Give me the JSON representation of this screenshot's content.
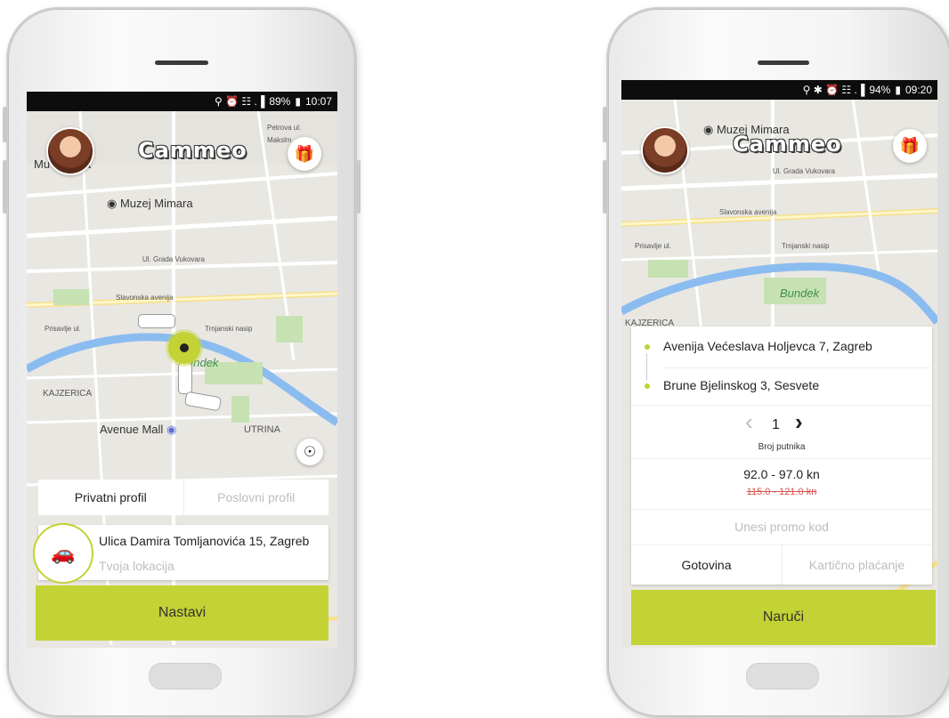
{
  "phone1": {
    "status": {
      "icons": "⚲ ⏰ ☷ .▐",
      "battery": "89%",
      "time": "10:07"
    },
    "brand": "Cammeo",
    "map_labels": {
      "poi_left": "Mu",
      "poi_left2": "ja",
      "muzej": "Muzej Mimara",
      "grada": "Ul. Grada Vukovara",
      "slavonska": "Slavonska avenija",
      "prisavlje": "Prisavlje ul.",
      "trnjanski": "Trnjanski nasip",
      "bundek": "undek",
      "kajzerica": "KAJZERICA",
      "avenue_mall": "Avenue Mall",
      "utrina": "UTRINA",
      "makslm": "Makslm",
      "petrova": "Petrova ul."
    },
    "profile_tabs": {
      "private": "Privatni profil",
      "business": "Poslovni profil"
    },
    "address": {
      "from": "Ulica Damira Tomljanovića 15, Zagreb",
      "location_placeholder": "Tvoja lokacija"
    },
    "continue_button": "Nastavi"
  },
  "phone2": {
    "status": {
      "icons": "⚲ ✱ ⏰ ☷ .▐",
      "battery": "94%",
      "time": "09:20"
    },
    "brand": "Cammeo",
    "map_labels": {
      "muzej": "Muzej Mimara",
      "grada": "Ul. Grada Vukovara",
      "slavonska": "Slavonska avenija",
      "prisavlje": "Prisavlje ul.",
      "trnjanski": "Trnjanski nasip",
      "bundek": "Bundek",
      "kajzerica": "KAJZERICA"
    },
    "route": {
      "from": "Avenija Većeslava Holjevca 7, Zagreb",
      "to": "Brune Bjelinskog 3, Sesvete"
    },
    "passengers": {
      "count": "1",
      "label": "Broj putnika"
    },
    "price": {
      "current": "92.0 - 97.0 kn",
      "old": "115.0 - 121.0 kn"
    },
    "promo_placeholder": "Unesi promo kod",
    "payment": {
      "cash": "Gotovina",
      "card": "Kartično plaćanje"
    },
    "order_button": "Naruči"
  },
  "colors": {
    "accent": "#c3d234",
    "river": "#8bbcf0",
    "park": "#c6e2b2"
  },
  "icons": [
    "gift-icon",
    "location-target-icon",
    "car-icon",
    "chevron-left-icon",
    "chevron-right-icon"
  ]
}
